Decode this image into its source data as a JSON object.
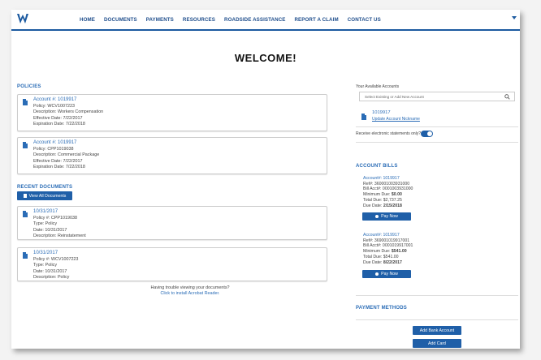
{
  "nav": {
    "items": [
      "HOME",
      "DOCUMENTS",
      "PAYMENTS",
      "RESOURCES",
      "ROADSIDE ASSISTANCE",
      "REPORT A CLAIM",
      "CONTACT US"
    ]
  },
  "page": {
    "title": "WELCOME!"
  },
  "policies": {
    "heading": "POLICIES",
    "cards": [
      {
        "account": "Account #: 1019917",
        "policy": "Policy: WCV1007223",
        "description": "Description: Workers Compensation",
        "effective": "Effective Date: 7/22/2017",
        "expiration": "Expiration Date: 7/22/2018"
      },
      {
        "account": "Account #: 1019917",
        "policy": "Policy: CPP1019038",
        "description": "Description: Commercial Package",
        "effective": "Effective Date: 7/22/2017",
        "expiration": "Expiration Date: 7/22/2018"
      }
    ]
  },
  "recent_documents": {
    "heading": "RECENT DOCUMENTS",
    "view_all_label": "View All Documents",
    "cards": [
      {
        "date_link": "10/31/2017",
        "policy": "Policy #: CPP1019038",
        "type": "Type: Policy",
        "date": "Date: 10/31/2017",
        "description": "Description: Reinstatement"
      },
      {
        "date_link": "10/31/2017",
        "policy": "Policy #: WCV1007223",
        "type": "Type: Policy",
        "date": "Date: 10/31/2017",
        "description": "Description: Policy"
      }
    ],
    "trouble_text": "Having trouble viewing your documents?",
    "acrobat_link": "Click to install Acrobat Reader."
  },
  "accounts": {
    "label": "Your Available Accounts",
    "select_placeholder": "Select Existing or Add New Account",
    "account_number": "1019917",
    "nickname_link": "Update Account Nickname",
    "estatements_label": "Receive electronic statements only?"
  },
  "account_bills": {
    "heading": "ACCOUNT BILLS",
    "bills": [
      {
        "account": "Account#: 1019917",
        "ref": "Ref#: 360001003931000",
        "bill_acct": "Bill Acct#: 0001003931000",
        "min_due": "Minimum Due: ",
        "min_due_value": "$0.00",
        "total_due": "Total Due: $2,737.25",
        "due_date": "Due Date: ",
        "due_date_value": "2/15/2018",
        "pay_label": "Pay Now"
      },
      {
        "account": "Account#: 1019917",
        "ref": "Ref#: 369001019917001",
        "bill_acct": "Bill Acct#: 0001019917001",
        "min_due": "Minimum Due: ",
        "min_due_value": "$541.00",
        "total_due": "Total Due: $541.00",
        "due_date": "Due Date: ",
        "due_date_value": "8/22/2017",
        "pay_label": "Pay Now"
      }
    ]
  },
  "payment_methods": {
    "heading": "PAYMENT METHODS",
    "add_bank_label": "Add Bank Account",
    "add_card_label": "Add Card"
  }
}
